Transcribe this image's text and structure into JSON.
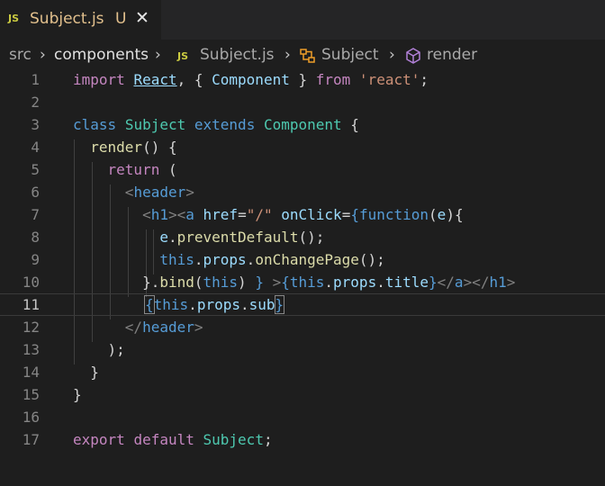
{
  "tab": {
    "icon_label": "JS",
    "filename": "Subject.js",
    "status": "U",
    "close_glyph": "✕"
  },
  "breadcrumb": {
    "src": "src",
    "components": "components",
    "file_icon": "JS",
    "file": "Subject.js",
    "class": "Subject",
    "method": "render"
  },
  "lines": [
    {
      "n": "1",
      "active": false
    },
    {
      "n": "2",
      "active": false
    },
    {
      "n": "3",
      "active": false
    },
    {
      "n": "4",
      "active": false
    },
    {
      "n": "5",
      "active": false
    },
    {
      "n": "6",
      "active": false
    },
    {
      "n": "7",
      "active": false
    },
    {
      "n": "8",
      "active": false
    },
    {
      "n": "9",
      "active": false
    },
    {
      "n": "10",
      "active": false
    },
    {
      "n": "11",
      "active": true
    },
    {
      "n": "12",
      "active": false
    },
    {
      "n": "13",
      "active": false
    },
    {
      "n": "14",
      "active": false
    },
    {
      "n": "15",
      "active": false
    },
    {
      "n": "16",
      "active": false
    },
    {
      "n": "17",
      "active": false
    }
  ],
  "code": {
    "l1": [
      "import",
      " ",
      "React",
      ", { ",
      "Component",
      " } ",
      "from",
      " ",
      "'react'",
      ";"
    ],
    "l3": [
      "class",
      " ",
      "Subject",
      " ",
      "extends",
      " ",
      "Component",
      " {"
    ],
    "l4": [
      "  ",
      "render",
      "() {"
    ],
    "l5": [
      "    ",
      "return",
      " ("
    ],
    "l6": [
      "      ",
      "<",
      "header",
      ">"
    ],
    "l7": [
      "        ",
      "<",
      "h1",
      ">",
      "<",
      "a",
      " ",
      "href",
      "=",
      "\"/\"",
      " ",
      "onClick",
      "=",
      "{",
      "function",
      "(",
      "e",
      "){"
    ],
    "l8": [
      "          ",
      "e",
      ".",
      "preventDefault",
      "();"
    ],
    "l9": [
      "          ",
      "this",
      ".",
      "props",
      ".",
      "onChangePage",
      "();"
    ],
    "l10": [
      "        ",
      "}",
      ".",
      "bind",
      "(",
      "this",
      ") ",
      "}",
      " >",
      "{",
      "this",
      ".",
      "props",
      ".",
      "title",
      "}",
      "</",
      "a",
      "></",
      "h1",
      ">"
    ],
    "l11": [
      "        ",
      "{",
      "this",
      ".",
      "props",
      ".",
      "sub",
      "}"
    ],
    "l12": [
      "      ",
      "</",
      "header",
      ">"
    ],
    "l13": [
      "    ",
      ");"
    ],
    "l14": [
      "  ",
      "}"
    ],
    "l15": [
      "}"
    ],
    "l17": [
      "export",
      " ",
      "default",
      " ",
      "Subject",
      ";"
    ]
  }
}
